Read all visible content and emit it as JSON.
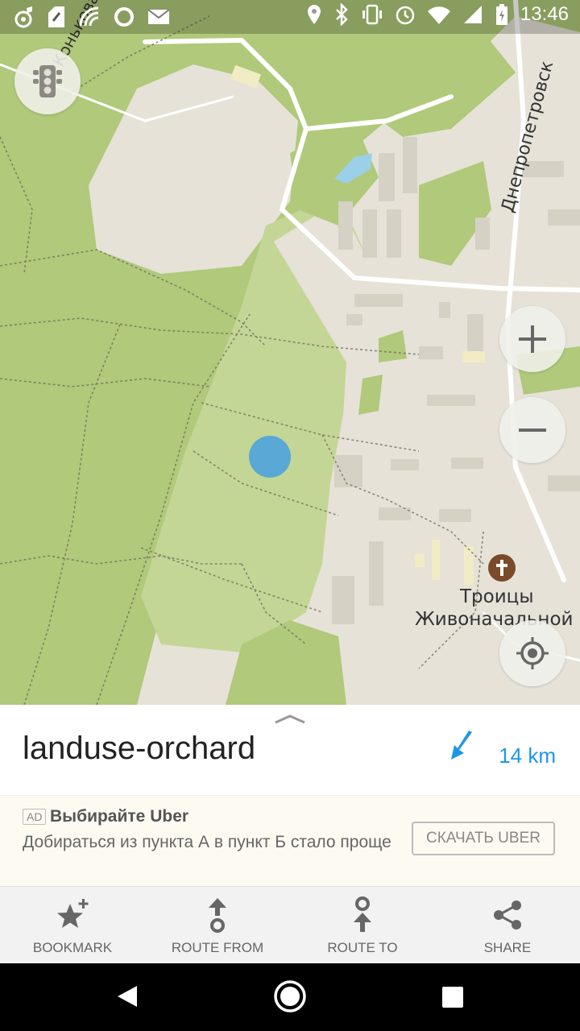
{
  "status_bar": {
    "time": "13:46",
    "left_icons": [
      "music-icon",
      "news-icon",
      "wifi-calling-icon",
      "circle-icon",
      "mail-icon"
    ],
    "right_icons": [
      "location-icon",
      "bluetooth-icon",
      "vibrate-icon",
      "alarm-icon",
      "wifi-icon",
      "signal-icon",
      "battery-icon"
    ]
  },
  "map": {
    "streets": [
      "Коньковая лыжн",
      "Днепропетровск"
    ],
    "poi": {
      "line1": "Троицы",
      "line2": "Живоначальной"
    },
    "controls": [
      "traffic-button",
      "zoom-in-button",
      "zoom-out-button",
      "my-location-button"
    ]
  },
  "place": {
    "name": "landuse-orchard",
    "distance": "14 km"
  },
  "ad": {
    "badge": "AD",
    "title": "Выбирайте Uber",
    "text": "Добираться из пункта А в пункт Б стало проще",
    "button": "СКАЧАТЬ UBER"
  },
  "actions": [
    {
      "label": "BOOKMARK",
      "icon": "bookmark-star-icon"
    },
    {
      "label": "ROUTE FROM",
      "icon": "route-from-icon"
    },
    {
      "label": "ROUTE TO",
      "icon": "route-to-icon"
    },
    {
      "label": "SHARE",
      "icon": "share-icon"
    }
  ],
  "colors": {
    "accent": "#1e96e6",
    "forest": "#b0c97a",
    "orchard": "#c4d696",
    "urban": "#e6e2d8",
    "location_dot": "#5aa8d6"
  }
}
